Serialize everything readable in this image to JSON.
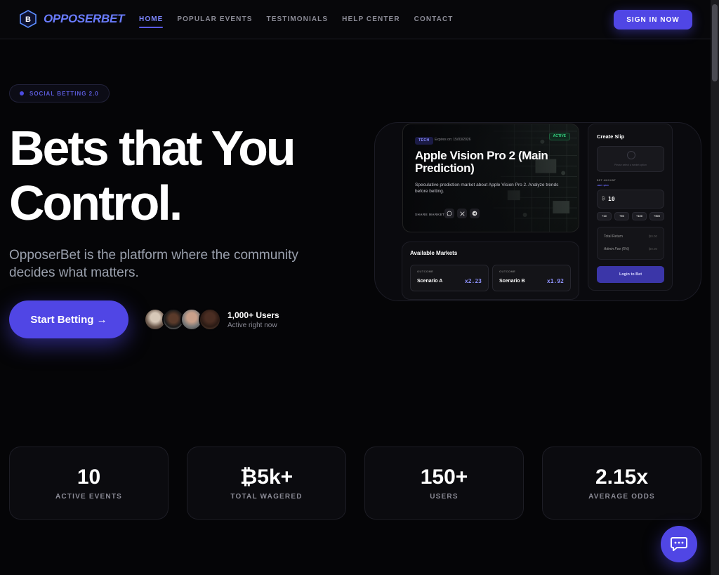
{
  "brand": {
    "name": "OPPOSERBET",
    "logo_letter": "B"
  },
  "nav": {
    "links": [
      "HOME",
      "POPULAR EVENTS",
      "TESTIMONIALS",
      "HELP CENTER",
      "CONTACT"
    ],
    "active": "HOME",
    "signin_label": "SIGN IN NOW"
  },
  "hero": {
    "badge": "SOCIAL BETTING 2.0",
    "title_line1": "Bets that You",
    "title_line2": "Control.",
    "subtitle": "OpposerBet is the platform where the community decides what matters.",
    "cta_label": "Start Betting →",
    "users_count": "1,000+ Users",
    "users_sub": "Active right now"
  },
  "event": {
    "tag": "TECH",
    "expires": "Expires on: 15/03/2026",
    "status": "ACTIVE",
    "title": "Apple Vision Pro 2 (Main Prediction)",
    "description": "Speculative prediction market about Apple Vision Pro 2. Analyze trends before betting.",
    "share_label": "SHARE MARKET:",
    "share_icons": [
      "whatsapp-icon",
      "x-icon",
      "telegram-icon"
    ]
  },
  "markets": {
    "title": "Available Markets",
    "items": [
      {
        "outcome_label": "OUTCOME",
        "name": "Scenario A",
        "odds": "x2.23"
      },
      {
        "outcome_label": "OUTCOME",
        "name": "Scenario B",
        "odds": "x1.92"
      }
    ]
  },
  "slip": {
    "title": "Create Slip",
    "select_placeholder": "Please select a market option",
    "bet_amount_label": "BET AMOUNT",
    "bet_limit": "LIMIT: ₿500",
    "currency": "₿",
    "amount": "10",
    "quick_amounts": [
      "+10",
      "+50",
      "+100",
      "+500"
    ],
    "total_return_label": "Total Return",
    "total_return_value": "₿0.00",
    "admin_fee_label": "Admin Fee (5%)",
    "admin_fee_value": "₿0.00",
    "login_label": "Login to Bet"
  },
  "stats": [
    {
      "value": "10",
      "label": "ACTIVE EVENTS"
    },
    {
      "value": "₿5k+",
      "label": "TOTAL WAGERED"
    },
    {
      "value": "150+",
      "label": "USERS"
    },
    {
      "value": "2.15x",
      "label": "AVERAGE ODDS"
    }
  ],
  "colors": {
    "accent": "#5046e5",
    "background": "#050507",
    "odds": "#8f93ff",
    "active_green": "#35d07f"
  }
}
